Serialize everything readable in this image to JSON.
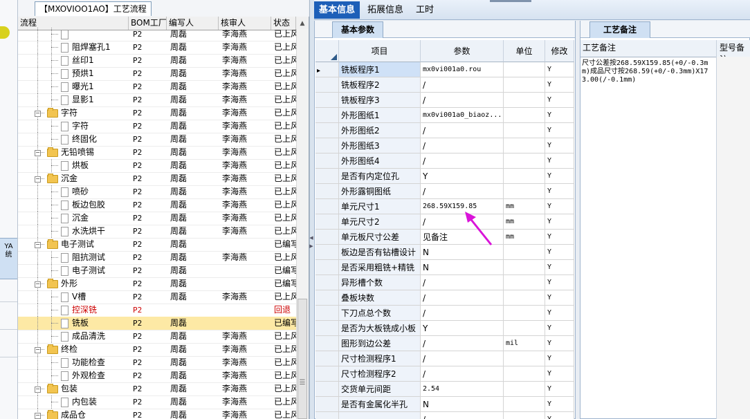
{
  "left_panel": {
    "title": "【MXOVIOO1AO】工艺流程",
    "columns": [
      "流程",
      "BOM工厂",
      "编写人",
      "核审人",
      "状态"
    ]
  },
  "side_tab": "YA\n统",
  "tree_rows": [
    {
      "level": 2,
      "name": "",
      "bom": "P2",
      "writer": "周磊",
      "reviewer": "李海燕",
      "status": "已上风",
      "folder": false,
      "partial": true
    },
    {
      "level": 2,
      "name": "阻焊塞孔1",
      "bom": "P2",
      "writer": "周磊",
      "reviewer": "李海燕",
      "status": "已上风",
      "folder": false
    },
    {
      "level": 2,
      "name": "丝印1",
      "bom": "P2",
      "writer": "周磊",
      "reviewer": "李海燕",
      "status": "已上风",
      "folder": false
    },
    {
      "level": 2,
      "name": "预烘1",
      "bom": "P2",
      "writer": "周磊",
      "reviewer": "李海燕",
      "status": "已上风",
      "folder": false
    },
    {
      "level": 2,
      "name": "曝光1",
      "bom": "P2",
      "writer": "周磊",
      "reviewer": "李海燕",
      "status": "已上风",
      "folder": false
    },
    {
      "level": 2,
      "name": "显影1",
      "bom": "P2",
      "writer": "周磊",
      "reviewer": "李海燕",
      "status": "已上风",
      "folder": false
    },
    {
      "level": 1,
      "name": "字符",
      "bom": "P2",
      "writer": "周磊",
      "reviewer": "李海燕",
      "status": "已上风",
      "folder": true
    },
    {
      "level": 2,
      "name": "字符",
      "bom": "P2",
      "writer": "周磊",
      "reviewer": "李海燕",
      "status": "已上风",
      "folder": false
    },
    {
      "level": 2,
      "name": "终固化",
      "bom": "P2",
      "writer": "周磊",
      "reviewer": "李海燕",
      "status": "已上风",
      "folder": false
    },
    {
      "level": 1,
      "name": "无铅喷锡",
      "bom": "P2",
      "writer": "周磊",
      "reviewer": "李海燕",
      "status": "已上风",
      "folder": true
    },
    {
      "level": 2,
      "name": "烘板",
      "bom": "P2",
      "writer": "周磊",
      "reviewer": "李海燕",
      "status": "已上风",
      "folder": false
    },
    {
      "level": 1,
      "name": "沉金",
      "bom": "P2",
      "writer": "周磊",
      "reviewer": "李海燕",
      "status": "已上风",
      "folder": true
    },
    {
      "level": 2,
      "name": "喷砂",
      "bom": "P2",
      "writer": "周磊",
      "reviewer": "李海燕",
      "status": "已上风",
      "folder": false
    },
    {
      "level": 2,
      "name": "板边包胶",
      "bom": "P2",
      "writer": "周磊",
      "reviewer": "李海燕",
      "status": "已上风",
      "folder": false
    },
    {
      "level": 2,
      "name": "沉金",
      "bom": "P2",
      "writer": "周磊",
      "reviewer": "李海燕",
      "status": "已上风",
      "folder": false
    },
    {
      "level": 2,
      "name": "水洗烘干",
      "bom": "P2",
      "writer": "周磊",
      "reviewer": "李海燕",
      "status": "已上风",
      "folder": false
    },
    {
      "level": 1,
      "name": "电子测试",
      "bom": "P2",
      "writer": "周磊",
      "reviewer": "",
      "status": "已编写",
      "folder": true
    },
    {
      "level": 2,
      "name": "阻抗测试",
      "bom": "P2",
      "writer": "周磊",
      "reviewer": "李海燕",
      "status": "已上风",
      "folder": false
    },
    {
      "level": 2,
      "name": "电子测试",
      "bom": "P2",
      "writer": "周磊",
      "reviewer": "",
      "status": "已编写",
      "folder": false
    },
    {
      "level": 1,
      "name": "外形",
      "bom": "P2",
      "writer": "周磊",
      "reviewer": "",
      "status": "已编写",
      "folder": true
    },
    {
      "level": 2,
      "name": "V槽",
      "bom": "P2",
      "writer": "周磊",
      "reviewer": "李海燕",
      "status": "已上风",
      "folder": false
    },
    {
      "level": 2,
      "name": "控深铣",
      "bom": "P2",
      "writer": "",
      "reviewer": "",
      "status": "回退",
      "folder": false,
      "red": true
    },
    {
      "level": 2,
      "name": "铣板",
      "bom": "P2",
      "writer": "周磊",
      "reviewer": "",
      "status": "已编写",
      "folder": false,
      "selected": true
    },
    {
      "level": 2,
      "name": "成品清洗",
      "bom": "P2",
      "writer": "周磊",
      "reviewer": "李海燕",
      "status": "已上风",
      "folder": false
    },
    {
      "level": 1,
      "name": "终检",
      "bom": "P2",
      "writer": "周磊",
      "reviewer": "李海燕",
      "status": "已上风",
      "folder": true
    },
    {
      "level": 2,
      "name": "功能检查",
      "bom": "P2",
      "writer": "周磊",
      "reviewer": "李海燕",
      "status": "已上风",
      "folder": false
    },
    {
      "level": 2,
      "name": "外观检查",
      "bom": "P2",
      "writer": "周磊",
      "reviewer": "李海燕",
      "status": "已上风",
      "folder": false
    },
    {
      "level": 1,
      "name": "包装",
      "bom": "P2",
      "writer": "周磊",
      "reviewer": "李海燕",
      "status": "已上风",
      "folder": true
    },
    {
      "level": 2,
      "name": "内包装",
      "bom": "P2",
      "writer": "周磊",
      "reviewer": "李海燕",
      "status": "已上风",
      "folder": false
    },
    {
      "level": 1,
      "name": "成品仓",
      "bom": "P2",
      "writer": "周磊",
      "reviewer": "李海燕",
      "status": "已上风",
      "folder": true
    }
  ],
  "main_tabs": [
    "基本信息",
    "拓展信息",
    "工时"
  ],
  "params": {
    "tab": "基本参数",
    "columns": [
      "项目",
      "参数",
      "单位",
      "修改"
    ],
    "rows": [
      {
        "item": "铣板程序1",
        "value": "mx0vi001a0.rou",
        "unit": "",
        "mod": "Y",
        "current": true
      },
      {
        "item": "铣板程序2",
        "value": "/",
        "unit": "",
        "mod": "Y"
      },
      {
        "item": "铣板程序3",
        "value": "/",
        "unit": "",
        "mod": "Y"
      },
      {
        "item": "外形图纸1",
        "value": "mx0vi001a0_biaoz...",
        "unit": "",
        "mod": "Y"
      },
      {
        "item": "外形图纸2",
        "value": "/",
        "unit": "",
        "mod": "Y"
      },
      {
        "item": "外形图纸3",
        "value": "/",
        "unit": "",
        "mod": "Y"
      },
      {
        "item": "外形图纸4",
        "value": "/",
        "unit": "",
        "mod": "Y"
      },
      {
        "item": "是否有内定位孔",
        "value": "Y",
        "unit": "",
        "mod": "Y"
      },
      {
        "item": "外形露铜图纸",
        "value": "/",
        "unit": "",
        "mod": "Y"
      },
      {
        "item": "单元尺寸1",
        "value": "268.59X159.85",
        "unit": "mm",
        "mod": "Y"
      },
      {
        "item": "单元尺寸2",
        "value": "/",
        "unit": "mm",
        "mod": "Y"
      },
      {
        "item": "单元板尺寸公差",
        "value": "见备注",
        "unit": "mm",
        "mod": "Y"
      },
      {
        "item": "板边是否有钻槽设计",
        "value": "N",
        "unit": "",
        "mod": "Y"
      },
      {
        "item": "是否采用粗铣+精铣",
        "value": "N",
        "unit": "",
        "mod": "Y"
      },
      {
        "item": "异形槽个数",
        "value": "/",
        "unit": "",
        "mod": "Y"
      },
      {
        "item": "叠板块数",
        "value": "/",
        "unit": "",
        "mod": "Y"
      },
      {
        "item": "下刀点总个数",
        "value": "/",
        "unit": "",
        "mod": "Y"
      },
      {
        "item": "是否为大板铣成小板",
        "value": "Y",
        "unit": "",
        "mod": "Y"
      },
      {
        "item": "图形到边公差",
        "value": "/",
        "unit": "mil",
        "mod": "Y"
      },
      {
        "item": "尺寸检测程序1",
        "value": "/",
        "unit": "",
        "mod": "Y"
      },
      {
        "item": "尺寸检测程序2",
        "value": "/",
        "unit": "",
        "mod": "Y"
      },
      {
        "item": "交货单元间距",
        "value": "2.54",
        "unit": "",
        "mod": "Y"
      },
      {
        "item": "是否有金属化半孔",
        "value": "N",
        "unit": "",
        "mod": "Y"
      },
      {
        "item": "",
        "value": "/",
        "unit": "",
        "mod": "Y",
        "partial": true
      }
    ]
  },
  "notes": {
    "tab": "工艺备注",
    "columns": [
      "工艺备注",
      "型号备注"
    ],
    "text": "尺寸公差按268.59X159.85(+0/-0.3mm)成品尺寸按268.59(+0/-0.3mm)X173.00(/-0.1mm)"
  },
  "colors": {
    "tab_active": "#1d5fb8",
    "selected_row": "#fde9a5",
    "annotation_arrow": "#d914d9",
    "returned_text": "#cc0000"
  },
  "icons": [
    "folder-icon",
    "document-icon",
    "tree-collapse-icon",
    "row-pointer-icon",
    "annotation-arrow-icon",
    "scroll-up-icon",
    "splitter-arrow-icon"
  ]
}
